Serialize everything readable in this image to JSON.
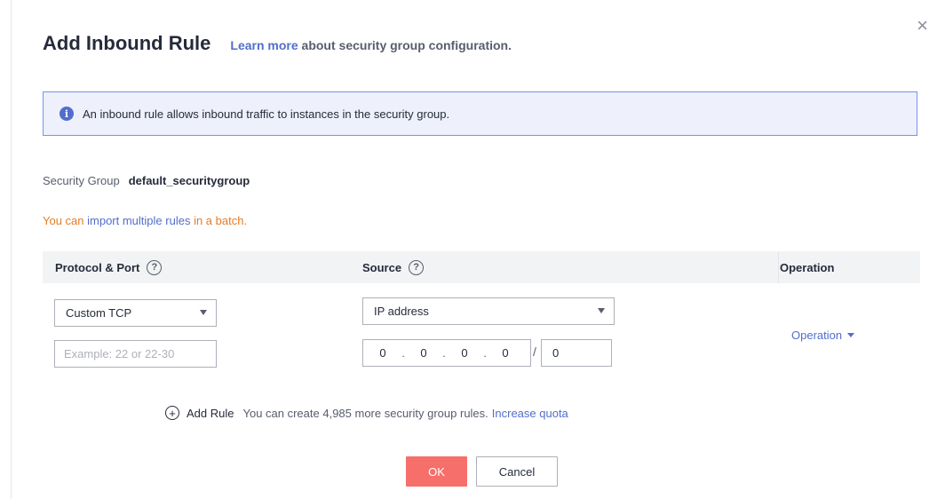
{
  "dialog": {
    "title": "Add Inbound Rule",
    "learn_more_link": "Learn more",
    "subtitle_rest": " about security group configuration.",
    "close_icon": "close-icon"
  },
  "info": {
    "icon": "info-icon",
    "text": "An inbound rule allows inbound traffic to instances in the security group."
  },
  "security_group": {
    "label": "Security Group",
    "value": "default_securitygroup"
  },
  "import_note": {
    "prefix": "You can ",
    "link": "import multiple rules",
    "suffix": " in a batch."
  },
  "table": {
    "headers": {
      "protocol_port": "Protocol & Port",
      "source": "Source",
      "operation": "Operation"
    },
    "row": {
      "protocol": "Custom TCP",
      "port_placeholder": "Example: 22 or 22-30",
      "source_type": "IP address",
      "ip_octets": [
        "0",
        "0",
        "0",
        "0"
      ],
      "ip_separator": ".",
      "slash": "/",
      "mask": "0",
      "operation": "Operation"
    }
  },
  "add_rule": {
    "label": "Add Rule",
    "quota_text": "You can create 4,985 more security group rules.",
    "increase_link": "Increase quota"
  },
  "footer": {
    "ok": "OK",
    "cancel": "Cancel"
  },
  "colors": {
    "primary": "#526ecc",
    "ok_button": "#f66f6a",
    "warning_text": "#e37d29",
    "info_bg": "#eef0fb"
  }
}
